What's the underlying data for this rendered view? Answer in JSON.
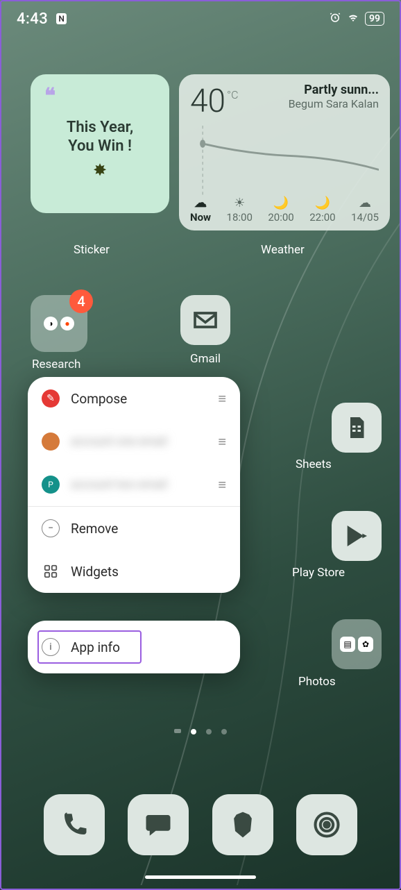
{
  "status": {
    "time": "4:43",
    "battery": "99"
  },
  "sticker": {
    "line1": "This Year,",
    "line2": "You Win !",
    "label": "Sticker"
  },
  "weather": {
    "temp": "40",
    "unit": "°C",
    "condition": "Partly sunn...",
    "location": "Begum Sara Kalan",
    "label": "Weather",
    "slots": [
      {
        "label": "Now",
        "type": "cloud-now"
      },
      {
        "label": "18:00",
        "type": "sun"
      },
      {
        "label": "20:00",
        "type": "moon"
      },
      {
        "label": "22:00",
        "type": "moon"
      },
      {
        "label": "14/05",
        "type": "cloud"
      }
    ]
  },
  "apps": {
    "research": {
      "label": "Research",
      "badge": "4"
    },
    "gmail": {
      "label": "Gmail"
    },
    "sheets": {
      "label": "Sheets"
    },
    "playstore": {
      "label": "Play Store"
    },
    "photos": {
      "label": "Photos"
    }
  },
  "ctx": {
    "compose": "Compose",
    "remove": "Remove",
    "widgets": "Widgets",
    "appinfo": "App info"
  }
}
